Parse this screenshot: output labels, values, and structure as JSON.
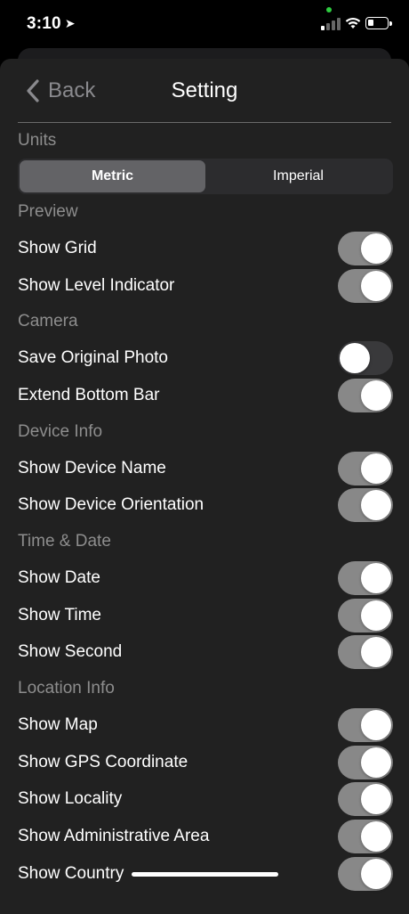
{
  "status_bar": {
    "time": "3:10"
  },
  "nav": {
    "back_label": "Back",
    "title": "Setting"
  },
  "units": {
    "header": "Units",
    "options": [
      "Metric",
      "Imperial"
    ],
    "selected": "Metric"
  },
  "sections": [
    {
      "header": "Preview",
      "rows": [
        {
          "label": "Show Grid",
          "on": true
        },
        {
          "label": "Show Level Indicator",
          "on": true
        }
      ]
    },
    {
      "header": "Camera",
      "rows": [
        {
          "label": "Save Original Photo",
          "on": false
        },
        {
          "label": "Extend Bottom Bar",
          "on": true
        }
      ]
    },
    {
      "header": "Device Info",
      "rows": [
        {
          "label": "Show Device Name",
          "on": true
        },
        {
          "label": "Show Device Orientation",
          "on": true
        }
      ]
    },
    {
      "header": "Time & Date",
      "rows": [
        {
          "label": "Show Date",
          "on": true
        },
        {
          "label": "Show Time",
          "on": true
        },
        {
          "label": "Show Second",
          "on": true
        }
      ]
    },
    {
      "header": "Location Info",
      "rows": [
        {
          "label": "Show Map",
          "on": true
        },
        {
          "label": "Show GPS Coordinate",
          "on": true
        },
        {
          "label": "Show Locality",
          "on": true
        },
        {
          "label": "Show Administrative Area",
          "on": true
        },
        {
          "label": "Show Country",
          "on": true
        }
      ]
    }
  ],
  "colors": {
    "toggle_on": "#888888",
    "toggle_off": "#39393b",
    "sheet": "#212121"
  }
}
